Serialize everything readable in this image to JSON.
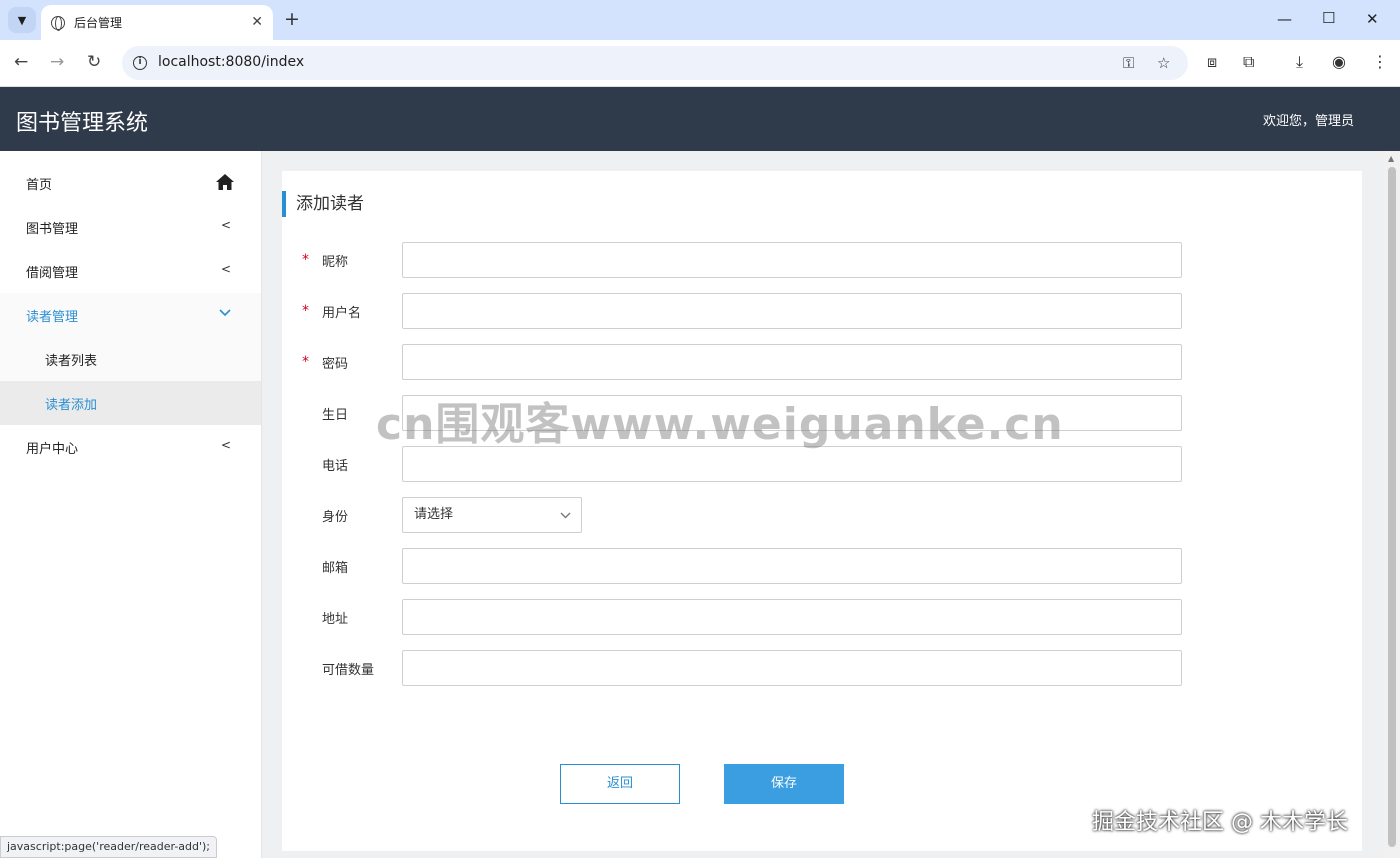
{
  "browser": {
    "tab_title": "后台管理",
    "url": "localhost:8080/index"
  },
  "app": {
    "title": "图书管理系统",
    "welcome": "欢迎您，管理员"
  },
  "sidebar": {
    "items": [
      {
        "label": "首页",
        "icon": "home-icon"
      },
      {
        "label": "图书管理",
        "icon": "chevron-left-icon"
      },
      {
        "label": "借阅管理",
        "icon": "chevron-left-icon"
      },
      {
        "label": "读者管理",
        "icon": "chevron-down-icon"
      },
      {
        "label": "读者列表"
      },
      {
        "label": "读者添加"
      },
      {
        "label": "用户中心",
        "icon": "chevron-left-icon"
      }
    ]
  },
  "form": {
    "title": "添加读者",
    "required_mark": "*",
    "fields": [
      {
        "label": "昵称",
        "value": ""
      },
      {
        "label": "用户名",
        "value": ""
      },
      {
        "label": "密码",
        "value": ""
      },
      {
        "label": "生日",
        "value": ""
      },
      {
        "label": "电话",
        "value": ""
      },
      {
        "label": "身份",
        "value": "请选择"
      },
      {
        "label": "邮箱",
        "value": ""
      },
      {
        "label": "地址",
        "value": ""
      },
      {
        "label": "可借数量",
        "value": ""
      }
    ],
    "back_label": "返回",
    "save_label": "保存"
  },
  "overlay": {
    "watermark": "cn围观客www.weiguanke.cn",
    "credit": "掘金技术社区 @ 木木学长",
    "status_url": "javascript:page('reader/reader-add');"
  },
  "colors": {
    "header_bg": "#2f3a4b",
    "accent": "#2a8fd2",
    "save_button": "#3a9ee0",
    "required": "#d0021b"
  }
}
